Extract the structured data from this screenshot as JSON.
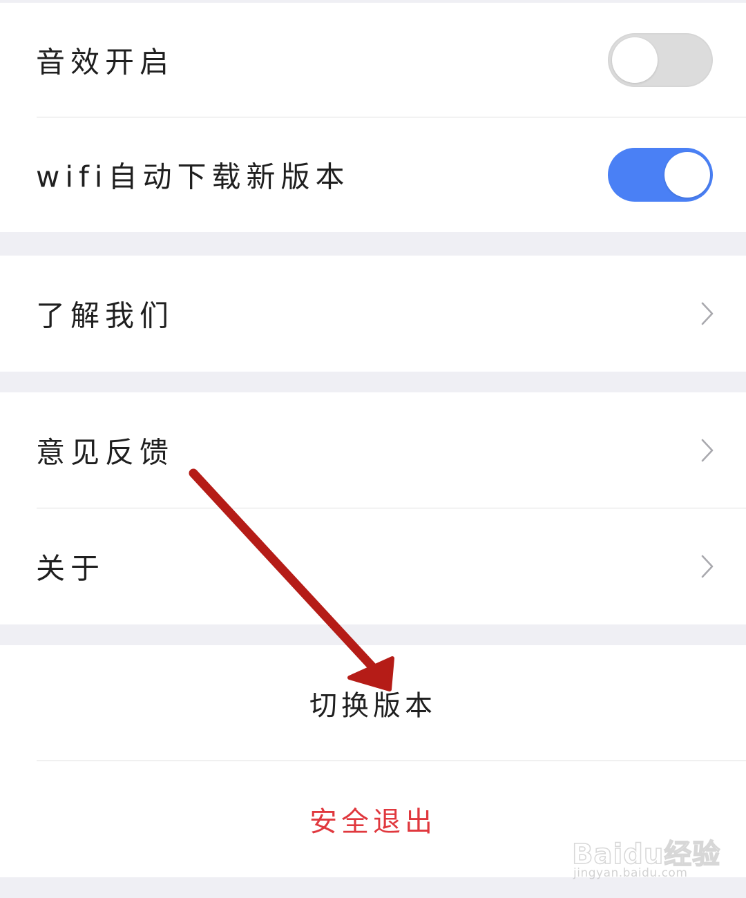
{
  "settings": {
    "sound_effects": {
      "label": "音效开启",
      "enabled": false
    },
    "wifi_auto_download": {
      "label": "wifi自动下载新版本",
      "enabled": true
    },
    "about_us": {
      "label": "了解我们"
    },
    "feedback": {
      "label": "意见反馈"
    },
    "about": {
      "label": "关于"
    },
    "switch_version": {
      "label": "切换版本"
    },
    "logout": {
      "label": "安全退出"
    }
  },
  "colors": {
    "toggle_on": "#4a80f5",
    "toggle_off": "#dcdcdc",
    "logout_text": "#e0383e",
    "annotation_arrow": "#b51c17",
    "group_separator": "#efeff4"
  },
  "icons": {
    "row_chevron": "chevron-right-icon",
    "annotation": "red-arrow-icon"
  },
  "watermark": {
    "logo_text": "Baidu经验",
    "url": "jingyan.baidu.com"
  }
}
